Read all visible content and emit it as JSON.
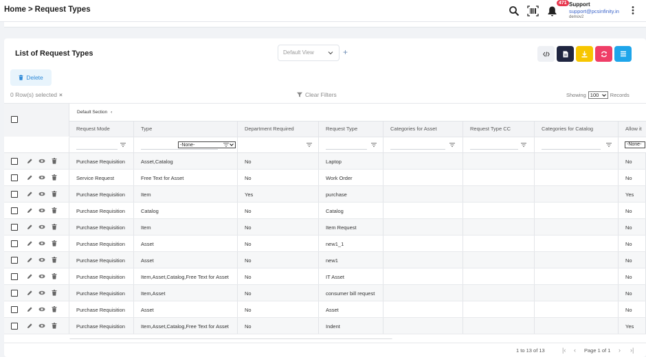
{
  "header": {
    "breadcrumb_home": "Home",
    "breadcrumb_sep": ">",
    "breadcrumb_current": "Request Types",
    "notification_count": "471",
    "support_name": "Support",
    "support_email": "support@pcsinfinity.in",
    "support_sub": "demov2"
  },
  "list": {
    "title": "List of Request Types",
    "view_selected": "Default View",
    "plus_label": "+",
    "delete_label": "Delete",
    "rows_selected": "0 Row(s) selected",
    "clear_label": "×",
    "clear_filters": "Clear Filters",
    "showing_label": "Showing",
    "page_size": "100",
    "records_label": "Records",
    "action_colors": {
      "code": "#eef0f4",
      "doc": "#1f2540",
      "download": "#f7c600",
      "refresh": "#ef3e67",
      "columns": "#1ea5ea"
    }
  },
  "grid": {
    "section_label": "Default Section",
    "section_toggle": "‹",
    "columns": [
      "Request Mode",
      "Type",
      "Department Required",
      "Request Type",
      "Categories for Asset",
      "Request Type CC",
      "Categories for Catalog",
      "Allow it"
    ],
    "filter_dept_value": "-None-",
    "filter_allow_value": "-None-",
    "rows": [
      {
        "mode": "Purchase Requisition",
        "type": "Asset,Catalog",
        "dept": "No",
        "rtype": "Laptop",
        "allow": "No"
      },
      {
        "mode": "Service Request",
        "type": "Free Text for Asset",
        "dept": "No",
        "rtype": "Work Order",
        "allow": "No"
      },
      {
        "mode": "Purchase Requisition",
        "type": "Item",
        "dept": "Yes",
        "rtype": "purchase",
        "allow": "Yes"
      },
      {
        "mode": "Purchase Requisition",
        "type": "Catalog",
        "dept": "No",
        "rtype": "Catalog",
        "allow": "No"
      },
      {
        "mode": "Purchase Requisition",
        "type": "Item",
        "dept": "No",
        "rtype": "Item Request",
        "allow": "No"
      },
      {
        "mode": "Purchase Requisition",
        "type": "Asset",
        "dept": "No",
        "rtype": "new1_1",
        "allow": "No"
      },
      {
        "mode": "Purchase Requisition",
        "type": "Asset",
        "dept": "No",
        "rtype": "new1",
        "allow": "No"
      },
      {
        "mode": "Purchase Requisition",
        "type": "Item,Asset,Catalog,Free Text for Asset",
        "dept": "No",
        "rtype": "IT Asset",
        "allow": "No"
      },
      {
        "mode": "Purchase Requisition",
        "type": "Item,Asset",
        "dept": "No",
        "rtype": "consumer bill request",
        "allow": "No"
      },
      {
        "mode": "Purchase Requisition",
        "type": "Asset",
        "dept": "No",
        "rtype": "Asset",
        "allow": "No"
      },
      {
        "mode": "Purchase Requisition",
        "type": "Item,Asset,Catalog,Free Text for Asset",
        "dept": "No",
        "rtype": "Indent",
        "allow": "Yes"
      }
    ]
  },
  "footer": {
    "range": "1 to 13 of 13",
    "page_label": "Page 1 of 1"
  }
}
